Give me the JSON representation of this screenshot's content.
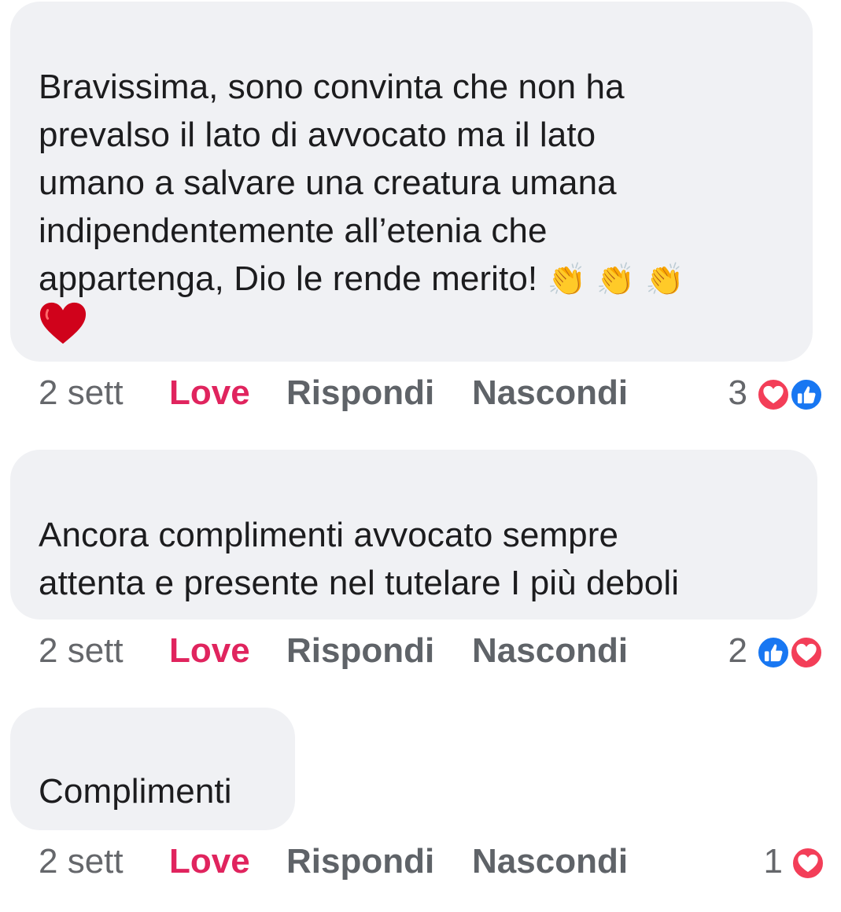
{
  "colors": {
    "bubble": "#f0f1f4",
    "love_action": "#e0245e",
    "muted_text": "#65676b",
    "love_reaction": "#f33e58",
    "like_reaction": "#1877f2"
  },
  "comments": [
    {
      "lines": [
        "Bravissima, sono convinta che non ha",
        "prevalso il lato di avvocato ma il lato",
        "umano a salvare una creatura umana",
        "indipendentemente all’etenia che",
        "appartenga, Dio le rende merito!"
      ],
      "trailing_emojis": [
        "clapping-hands",
        "clapping-hands",
        "clapping-hands",
        "red-heart"
      ],
      "time": "2 sett",
      "love_label": "Love",
      "reply_label": "Rispondi",
      "hide_label": "Nascondi",
      "reaction_count": "3",
      "reactions": [
        "love",
        "like"
      ]
    },
    {
      "lines": [
        "Ancora complimenti avvocato sempre",
        "attenta e presente nel tutelare I più deboli"
      ],
      "time": "2 sett",
      "love_label": "Love",
      "reply_label": "Rispondi",
      "hide_label": "Nascondi",
      "reaction_count": "2",
      "reactions": [
        "like",
        "love"
      ]
    },
    {
      "lines": [
        "Complimenti"
      ],
      "time": "2 sett",
      "love_label": "Love",
      "reply_label": "Rispondi",
      "hide_label": "Nascondi",
      "reaction_count": "1",
      "reactions": [
        "love"
      ]
    }
  ]
}
